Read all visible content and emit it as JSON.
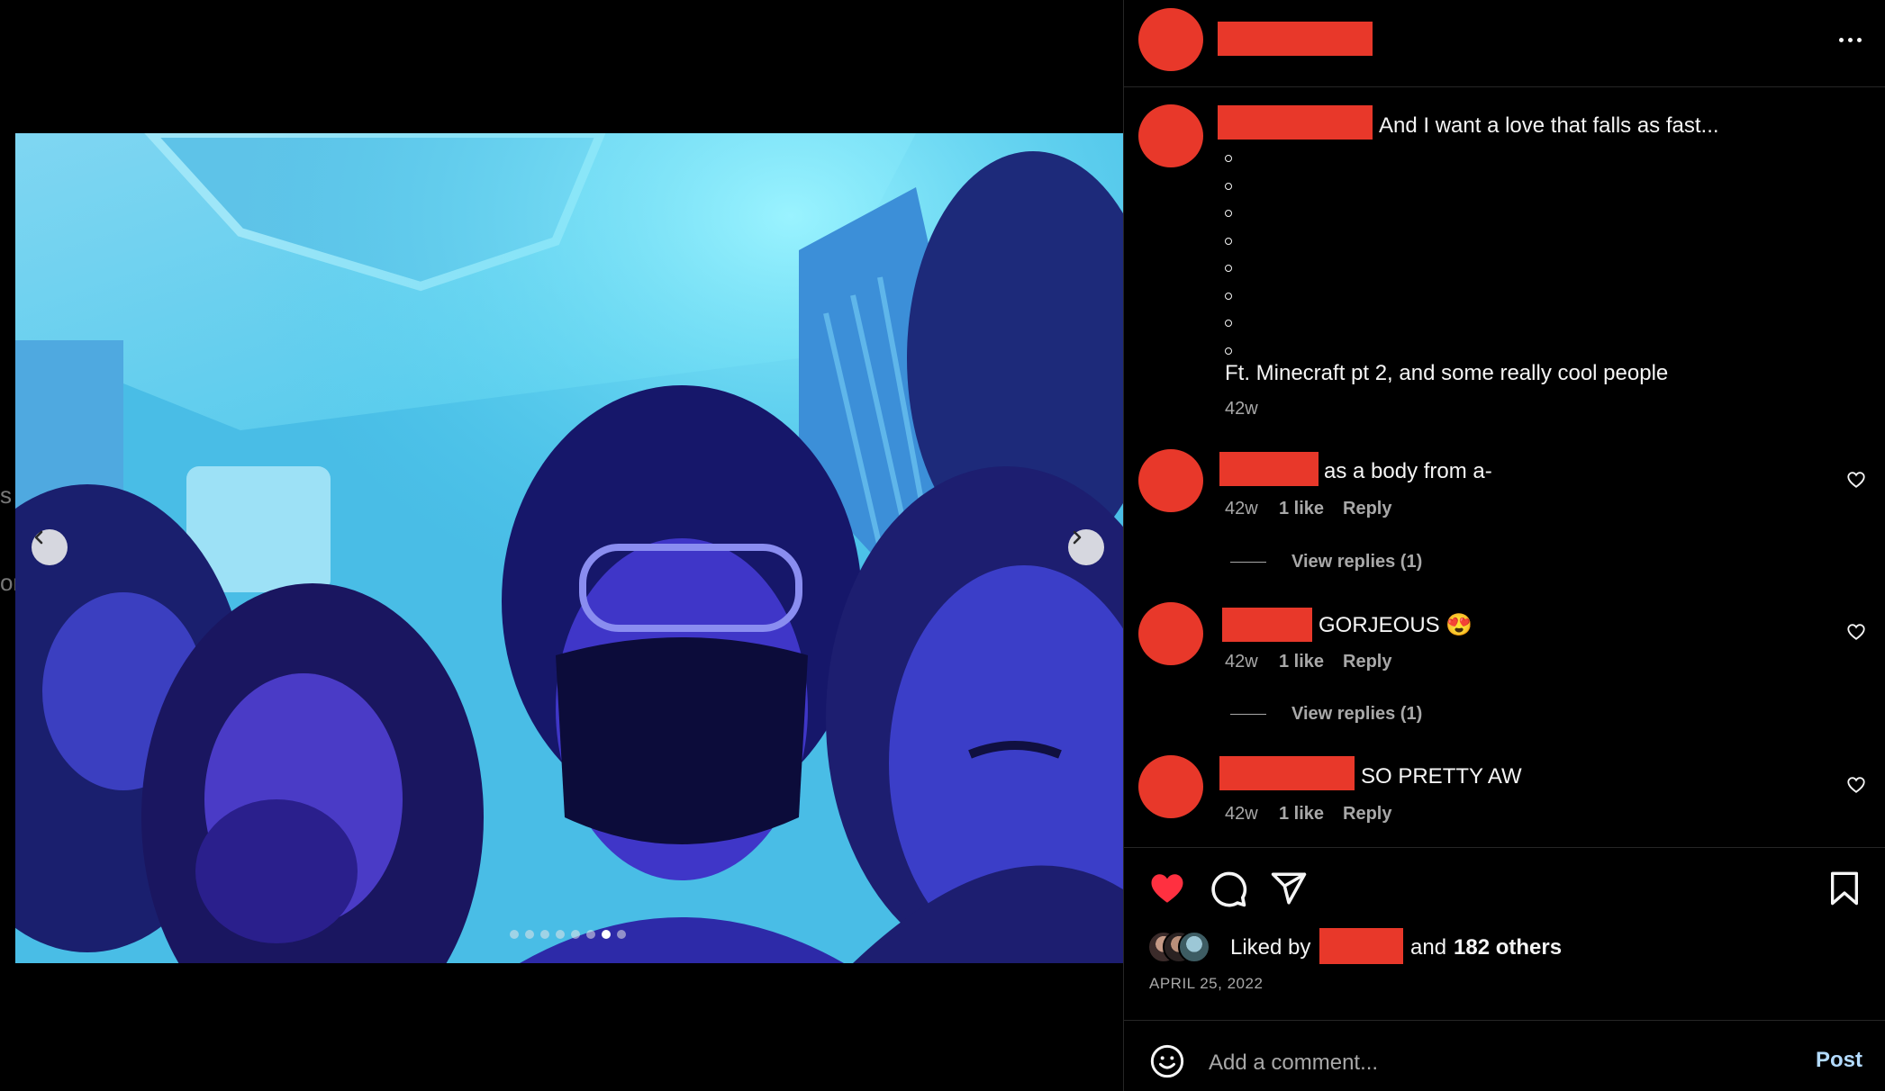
{
  "media": {
    "edge_text_1": "s",
    "edge_text_2": "or",
    "carousel_total": 8,
    "carousel_active_index": 6
  },
  "caption": {
    "text": "And I want a love that falls as fast...",
    "bullet_count": 8,
    "closing": "Ft. Minecraft pt 2, and some really cool people",
    "time": "42w"
  },
  "comments": [
    {
      "text": "as a body from a-",
      "time": "42w",
      "likes": "1 like",
      "reply_label": "Reply",
      "view_replies": "View replies (1)"
    },
    {
      "text": "GORJEOUS",
      "emoji": "😍",
      "time": "42w",
      "likes": "1 like",
      "reply_label": "Reply",
      "view_replies": "View replies (1)"
    },
    {
      "text": "SO PRETTY AW",
      "time": "42w",
      "likes": "1 like",
      "reply_label": "Reply"
    }
  ],
  "likes": {
    "prefix": "Liked by",
    "middle": "and",
    "others": "182 others"
  },
  "date": "APRIL 25, 2022",
  "comment_box": {
    "placeholder": "Add a comment...",
    "post_label": "Post"
  },
  "colors": {
    "redaction": "#e8382a",
    "like_active": "#ff3040",
    "post_link": "#b3dbff"
  },
  "icons": [
    "chevron-left-icon",
    "chevron-right-icon",
    "more-icon",
    "heart-icon",
    "comment-icon",
    "share-icon",
    "bookmark-icon",
    "emoji-icon"
  ]
}
